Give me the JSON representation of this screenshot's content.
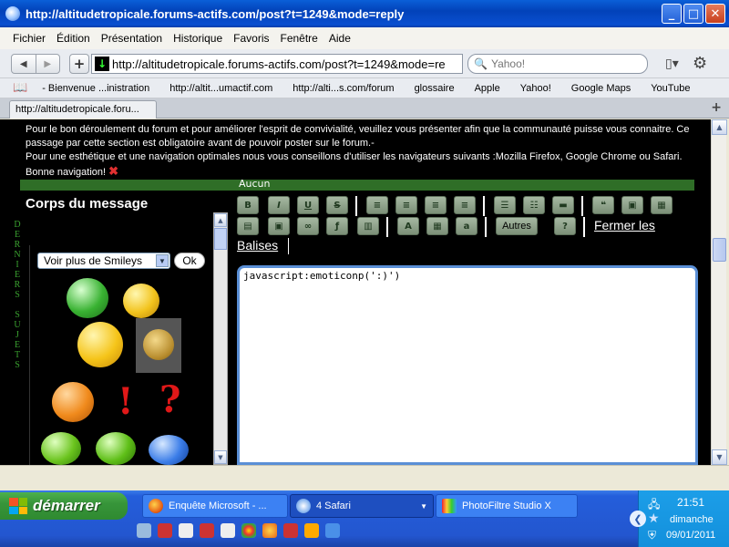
{
  "window": {
    "title": "http://altitudetropicale.forums-actifs.com/post?t=1249&mode=reply",
    "min_label": "_",
    "max_label": "□",
    "close_label": "✕"
  },
  "menu": [
    "Fichier",
    "Édition",
    "Présentation",
    "Historique",
    "Favoris",
    "Fenêtre",
    "Aide"
  ],
  "nav": {
    "url": "http://altitudetropicale.forums-actifs.com/post?t=1249&mode=re",
    "search_placeholder": "Yahoo!"
  },
  "bookmarks": [
    "- Bienvenue ...inistration",
    "http://altit...umactif.com",
    "http://alti...s.com/forum",
    "glossaire",
    "Apple",
    "Yahoo!",
    "Google Maps",
    "YouTube"
  ],
  "tab": {
    "label": "http://altitudetropicale.foru..."
  },
  "notice": {
    "line1": "Pour le bon déroulement du forum et pour améliorer l'esprit de convivialité, veuillez vous présenter afin que la communauté puisse vous connaitre. Ce passage par cette section est obligatoire avant de pouvoir poster sur le forum.-",
    "line2": "Pour une esthétique et une navigation optimales nous vous conseillons d'utiliser les navigateurs suivants :Mozilla Firefox, Google Chrome ou Safari.",
    "line3": "Bonne navigation!"
  },
  "strip": {
    "label": "Aucun"
  },
  "sidebar_deco": [
    "D",
    "E",
    "R",
    "N",
    "I",
    "E",
    "R",
    "S",
    "",
    "S",
    "U",
    "J",
    "E",
    "T",
    "S"
  ],
  "editor": {
    "section_title": "Corps du message",
    "toolbar": {
      "bold": "B",
      "italic": "I",
      "underline": "U",
      "strike": "S",
      "autres": "Autres",
      "fermer": "Fermer les",
      "balises": "Balises"
    },
    "content": "javascript:emoticonp(':)')"
  },
  "smileys": {
    "select_value": "Voir plus de Smileys",
    "ok_label": "Ok",
    "excl": "!",
    "quest": "?"
  },
  "taskbar": {
    "start_label": "démarrer",
    "tasks": [
      "Enquête Microsoft - ...",
      "4 Safari",
      "PhotoFiltre Studio X"
    ],
    "clock": "21:51",
    "day": "dimanche",
    "date": "09/01/2011"
  }
}
